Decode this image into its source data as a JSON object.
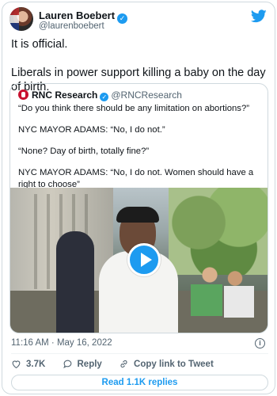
{
  "tweet": {
    "author": {
      "display_name": "Lauren Boebert",
      "handle": "@laurenboebert",
      "verified_icon": "verified-badge-icon"
    },
    "text_lines": [
      "It is official.",
      "Liberals in power support killing a baby on the day of birth."
    ],
    "timestamp": "11:16 AM · May 16, 2022",
    "brand_icon": "twitter-bird-icon",
    "brand_color": "#1d9bf0"
  },
  "quote": {
    "author": {
      "display_name": "RNC Research",
      "handle": "@RNCResearch"
    },
    "paragraphs": [
      "“Do you think there should be any limitation on abortions?”",
      "NYC MAYOR ADAMS: “No, I do not.”",
      "“None? Day of birth, totally fine?”",
      "NYC MAYOR ADAMS: “No, I do not. Women should have a right to choose”"
    ],
    "media": {
      "type": "video",
      "play_icon": "play-icon"
    }
  },
  "actions": {
    "like_count": "3.7K",
    "reply_label": "Reply",
    "copy_link_label": "Copy link to Tweet"
  },
  "replies_button": "Read 1.1K replies",
  "info_icon_glyph": "i"
}
